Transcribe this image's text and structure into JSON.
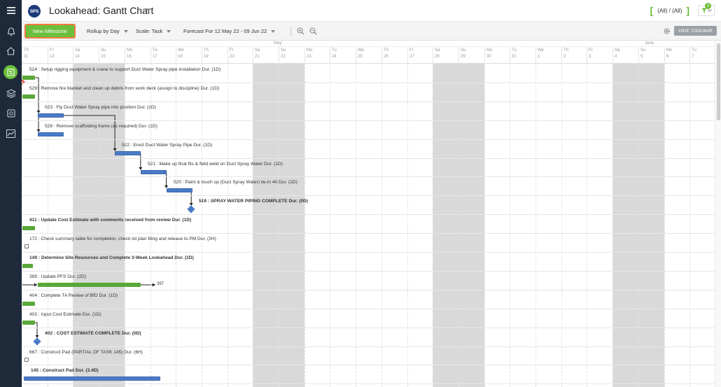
{
  "header": {
    "logo_text": "SPS",
    "title": "Lookahead: Gantt Chart",
    "scope_filter": "(All) / (All)",
    "filter_badge": "3"
  },
  "toolbar": {
    "new_milestone_label": "New Milestone",
    "rollup_label": "Rollup by Day",
    "scale_label": "Scale: Task",
    "forecast_label": "Forecast For 12 May 22 - 09 Jun 22",
    "hide_toolbar_label": "HIDE TOOLBAR"
  },
  "colors": {
    "brand_green": "#6bbf3c",
    "task_bar_green": "#59a83a",
    "task_bar_blue": "#4a7bc8",
    "rail_dark": "#1e2a3a",
    "highlight_orange": "#f07b3f",
    "today_red": "#e74c3c"
  },
  "timeline": {
    "months": [
      "May",
      "June"
    ],
    "days": [
      {
        "dn": "Th",
        "dd": "11",
        "weekend": false
      },
      {
        "dn": "Fr",
        "dd": "13",
        "weekend": false
      },
      {
        "dn": "Sa",
        "dd": "14",
        "weekend": true
      },
      {
        "dn": "Su",
        "dd": "15",
        "weekend": true
      },
      {
        "dn": "Mo",
        "dd": "16",
        "weekend": false
      },
      {
        "dn": "Tu",
        "dd": "17",
        "weekend": false
      },
      {
        "dn": "We",
        "dd": "18",
        "weekend": false
      },
      {
        "dn": "Th",
        "dd": "19",
        "weekend": false
      },
      {
        "dn": "Fr",
        "dd": "20",
        "weekend": false
      },
      {
        "dn": "Sa",
        "dd": "21",
        "weekend": true
      },
      {
        "dn": "Su",
        "dd": "22",
        "weekend": true
      },
      {
        "dn": "Mo",
        "dd": "23",
        "weekend": false
      },
      {
        "dn": "Tu",
        "dd": "24",
        "weekend": false
      },
      {
        "dn": "We",
        "dd": "25",
        "weekend": false
      },
      {
        "dn": "Th",
        "dd": "26",
        "weekend": false
      },
      {
        "dn": "Fr",
        "dd": "27",
        "weekend": false
      },
      {
        "dn": "Sa",
        "dd": "28",
        "weekend": true
      },
      {
        "dn": "Su",
        "dd": "29",
        "weekend": true
      },
      {
        "dn": "Mo",
        "dd": "30",
        "weekend": false
      },
      {
        "dn": "Tu",
        "dd": "31",
        "weekend": false
      },
      {
        "dn": "We",
        "dd": "1",
        "weekend": false
      },
      {
        "dn": "Th",
        "dd": "2",
        "weekend": false
      },
      {
        "dn": "Fr",
        "dd": "3",
        "weekend": false
      },
      {
        "dn": "Sa",
        "dd": "4",
        "weekend": true
      },
      {
        "dn": "Su",
        "dd": "5",
        "weekend": true
      },
      {
        "dn": "Mo",
        "dd": "6",
        "weekend": false
      },
      {
        "dn": "Tu",
        "dd": "7",
        "weekend": false
      }
    ]
  },
  "tasks": [
    {
      "id": "524",
      "label": "524 : Setup rigging equipment & crane to support Duct Water Spray pipe installation Dur. (1D)",
      "bold": false,
      "bar": "green",
      "start": 0,
      "dur": 0.5,
      "row": 0
    },
    {
      "id": "529",
      "label": "529 : Remove fire blanket and clean up debris from work deck (assign to discipline) Dur. (1D)",
      "bold": false,
      "bar": "green",
      "start": 0,
      "dur": 0.5,
      "row": 1
    },
    {
      "id": "523",
      "label": "523 : Fly Duct Water Spray pipe into position Dur. (1D)",
      "bold": false,
      "bar": "blue",
      "start": 0.6,
      "dur": 1,
      "row": 2
    },
    {
      "id": "528",
      "label": "528 : Remove scaffolding frame (as required) Dur. (1D)",
      "bold": false,
      "bar": "blue",
      "start": 0.6,
      "dur": 1,
      "row": 3
    },
    {
      "id": "522",
      "label": "522 : Erect Duct Water Spray Pipe Dur. (1D)",
      "bold": false,
      "bar": "blue",
      "start": 3.6,
      "dur": 1,
      "row": 4
    },
    {
      "id": "521",
      "label": "521 : Make up final fits & field weld on Duct Spray Water Dur. (1D)",
      "bold": false,
      "bar": "blue",
      "start": 4.6,
      "dur": 1,
      "row": 5
    },
    {
      "id": "520",
      "label": "520 : Paint & touch up (Duct Spray Water) tie-in 40 Dur. (1D)",
      "bold": false,
      "bar": "blue",
      "start": 5.6,
      "dur": 1,
      "row": 6
    },
    {
      "id": "519",
      "label": "519 : SPRAY WATER PIPING COMPLETE Dur. (0D)",
      "bold": true,
      "bar": "milestone",
      "start": 6.6,
      "dur": 0,
      "row": 7
    },
    {
      "id": "411",
      "label": "411 : Update Cost Estimate with comments received from review Dur. (1D)",
      "bold": true,
      "bar": "green",
      "start": 0,
      "dur": 0.5,
      "row": 8
    },
    {
      "id": "172",
      "label": "172 : Check summary table for completion, check lot plan filing and release to PM Dur. (2H)",
      "bold": false,
      "bar": "box",
      "start": 0.05,
      "dur": 0,
      "row": 9
    },
    {
      "id": "149",
      "label": "149 : Determine Site Resources and Complete 3-Week Lookahead Dur. (1D)",
      "bold": true,
      "bar": "green",
      "start": 0,
      "dur": 0.4,
      "row": 10
    },
    {
      "id": "399",
      "label": "399 : Update PFS Dur. (2D)",
      "bold": false,
      "bar": "green",
      "start": 0.6,
      "dur": 4,
      "row": 11,
      "successor": "397"
    },
    {
      "id": "404",
      "label": "404 : Complete TA Review of BfD Dur. (1D)",
      "bold": false,
      "bar": "green",
      "start": 0,
      "dur": 0.5,
      "row": 12
    },
    {
      "id": "403",
      "label": "403 : Input Cost Estimate Dur. (1D)",
      "bold": false,
      "bar": "green",
      "start": 0,
      "dur": 0.5,
      "row": 13
    },
    {
      "id": "402",
      "label": "402 : COST ESTIMATE COMPLETE Dur. (0D)",
      "bold": true,
      "bar": "milestone",
      "start": 0.6,
      "dur": 0,
      "row": 14
    },
    {
      "id": "667",
      "label": "667 : Construct Pad (PARTIAL OF TASK 145) Dur. (6H)",
      "bold": false,
      "bar": "box",
      "start": 0.05,
      "dur": 0,
      "row": 15
    },
    {
      "id": "145",
      "label": "145 : Construct Pad Dur. (3.4D)",
      "bold": true,
      "bar": "blue",
      "start": 0.05,
      "dur": 5.3,
      "row": 16
    }
  ]
}
